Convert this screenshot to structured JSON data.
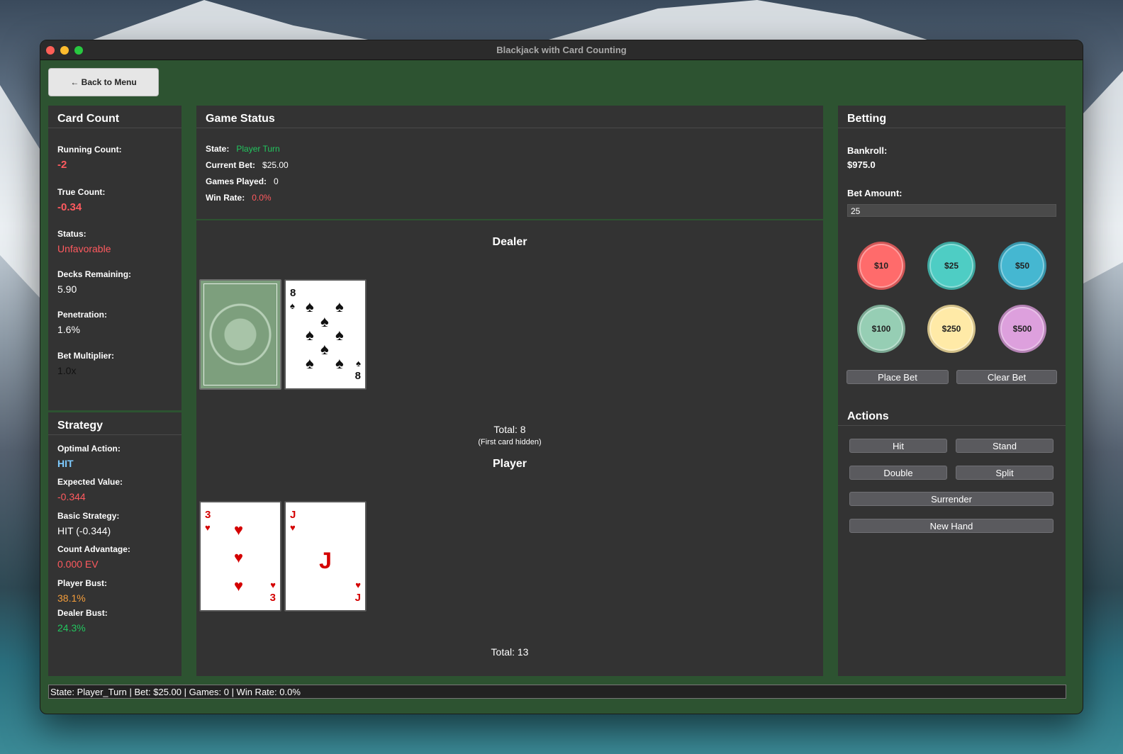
{
  "window": {
    "title": "Blackjack with Card Counting"
  },
  "back_button": "← Back to Menu",
  "card_count": {
    "title": "Card Count",
    "running_count_label": "Running Count:",
    "running_count": "-2",
    "true_count_label": "True Count:",
    "true_count": "-0.34",
    "status_label": "Status:",
    "status": "Unfavorable",
    "decks_label": "Decks Remaining:",
    "decks": "5.90",
    "penetration_label": "Penetration:",
    "penetration": "1.6%",
    "bet_mult_label": "Bet Multiplier:",
    "bet_mult": "1.0x"
  },
  "strategy": {
    "title": "Strategy",
    "optimal_label": "Optimal Action:",
    "optimal": "HIT",
    "ev_label": "Expected Value:",
    "ev": "-0.344",
    "basic_label": "Basic Strategy:",
    "basic": "HIT (-0.344)",
    "count_adv_label": "Count Advantage:",
    "count_adv": "0.000 EV",
    "player_bust_label": "Player Bust:",
    "player_bust": "38.1%",
    "dealer_bust_label": "Dealer Bust:",
    "dealer_bust": "24.3%"
  },
  "game_status": {
    "title": "Game Status",
    "state_label": "State:",
    "state": "Player Turn",
    "bet_label": "Current Bet:",
    "bet": "$25.00",
    "games_label": "Games Played:",
    "games": "0",
    "winrate_label": "Win Rate:",
    "winrate": "0.0%"
  },
  "dealer": {
    "label": "Dealer",
    "total": "Total: 8",
    "note": "(First card hidden)",
    "cards": [
      {
        "hidden": true
      },
      {
        "rank": "8",
        "suit": "♠",
        "suit_name": "spades"
      }
    ]
  },
  "player": {
    "label": "Player",
    "total": "Total: 13",
    "cards": [
      {
        "rank": "3",
        "suit": "♥",
        "suit_name": "hearts"
      },
      {
        "rank": "J",
        "suit": "♥",
        "suit_name": "hearts"
      }
    ]
  },
  "betting": {
    "title": "Betting",
    "bankroll_label": "Bankroll:",
    "bankroll": "$975.0",
    "bet_amount_label": "Bet Amount:",
    "bet_amount": "25",
    "chips": [
      {
        "label": "$10",
        "color": "#ff6b6b"
      },
      {
        "label": "$25",
        "color": "#4ecdc4"
      },
      {
        "label": "$50",
        "color": "#45b7d1"
      },
      {
        "label": "$100",
        "color": "#96ceb4"
      },
      {
        "label": "$250",
        "color": "#ffeaa7"
      },
      {
        "label": "$500",
        "color": "#dda0dd"
      }
    ],
    "place_bet": "Place Bet",
    "clear_bet": "Clear Bet"
  },
  "actions": {
    "title": "Actions",
    "hit": "Hit",
    "stand": "Stand",
    "double": "Double",
    "split": "Split",
    "surrender": "Surrender",
    "new_hand": "New Hand"
  },
  "statusbar": "State: Player_Turn | Bet: $25.00 | Games: 0 | Win Rate: 0.0%"
}
